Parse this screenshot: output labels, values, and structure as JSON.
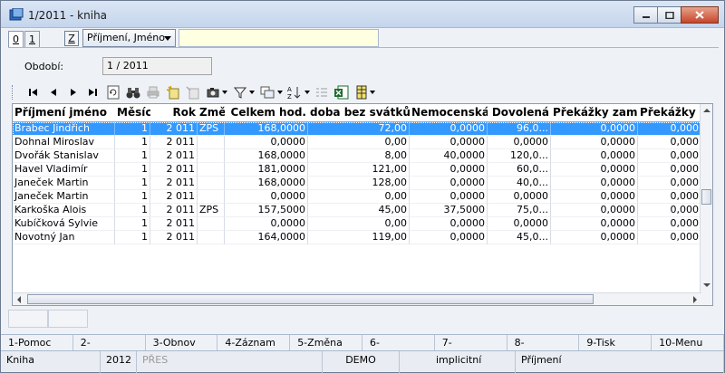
{
  "window": {
    "title": "1/2011 - kniha"
  },
  "tabs": [
    "0",
    "1"
  ],
  "z_button": "Z",
  "sort": {
    "selected": "Příjmení, Jméno"
  },
  "search": {
    "value": "",
    "placeholder": ""
  },
  "obdobi": {
    "label": "Období:",
    "value": "1 / 2011"
  },
  "grid": {
    "headers": [
      "Příjmení jméno",
      "Měsíc",
      "Rok",
      "Změ",
      "Celkem hod.",
      "doba bez svátků",
      "Nemocenská",
      "Dovolená",
      "Překážky zam.",
      "Překážky org"
    ],
    "rows": [
      [
        "Brabec Jindřich",
        "1",
        "2 011",
        "ZPS",
        "168,0000",
        "72,00",
        "0,0000",
        "96,0...",
        "0,0000",
        "0,000"
      ],
      [
        "Dohnal Miroslav",
        "1",
        "2 011",
        "",
        "0,0000",
        "0,00",
        "0,0000",
        "0,0000",
        "0,0000",
        "0,000"
      ],
      [
        "Dvořák Stanislav",
        "1",
        "2 011",
        "",
        "168,0000",
        "8,00",
        "40,0000",
        "120,0...",
        "0,0000",
        "0,000"
      ],
      [
        "Havel Vladimír",
        "1",
        "2 011",
        "",
        "181,0000",
        "121,00",
        "0,0000",
        "60,0...",
        "0,0000",
        "0,000"
      ],
      [
        "Janeček Martin",
        "1",
        "2 011",
        "",
        "168,0000",
        "128,00",
        "0,0000",
        "40,0...",
        "0,0000",
        "0,000"
      ],
      [
        "Janeček Martin",
        "1",
        "2 011",
        "",
        "0,0000",
        "0,00",
        "0,0000",
        "0,0000",
        "0,0000",
        "0,000"
      ],
      [
        "Karkoška Alois",
        "1",
        "2 011",
        "ZPS",
        "157,5000",
        "45,00",
        "37,5000",
        "75,0...",
        "0,0000",
        "0,000"
      ],
      [
        "Kubíčková Sylvie",
        "1",
        "2 011",
        "",
        "0,0000",
        "0,00",
        "0,0000",
        "0,0000",
        "0,0000",
        "0,000"
      ],
      [
        "Novotný Jan",
        "1",
        "2 011",
        "",
        "164,0000",
        "119,00",
        "0,0000",
        "45,0...",
        "0,0000",
        "0,000"
      ]
    ]
  },
  "fkeys": [
    "1-Pomoc",
    "2-",
    "3-Obnov",
    "4-Záznam",
    "5-Změna",
    "6-",
    "7-",
    "8-",
    "9-Tisk",
    "10-Menu"
  ],
  "status": {
    "module": "Kniha",
    "year": "2012",
    "pres": "PŘES",
    "db": "DEMO",
    "mode": "implicitní",
    "sort": "Příjmení"
  },
  "colors": {
    "selection": "#3399ff",
    "search_bg": "#ffffe1"
  },
  "icons": [
    "first-record-icon",
    "prev-record-icon",
    "next-record-icon",
    "last-record-icon",
    "refresh-icon",
    "binoculars-icon",
    "print-icon",
    "add-record-icon",
    "delete-record-icon",
    "camera-icon",
    "filter-icon",
    "copy-icon",
    "sort-az-icon",
    "list-icon",
    "excel-icon",
    "columns-icon"
  ]
}
